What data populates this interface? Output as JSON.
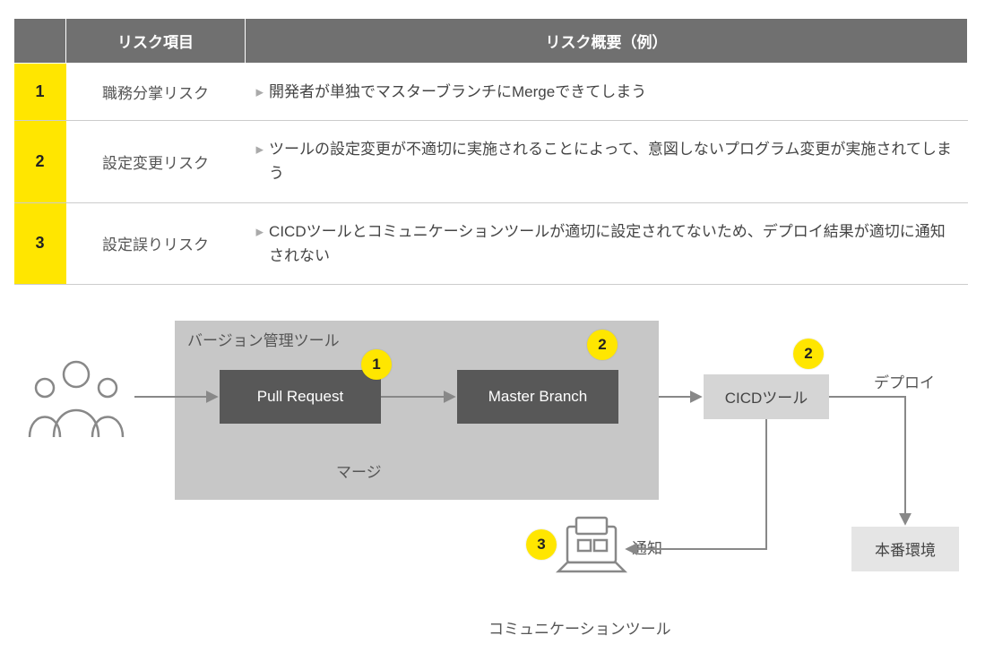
{
  "table": {
    "headers": {
      "num": "",
      "item": "リスク項目",
      "desc": "リスク概要（例）"
    },
    "rows": [
      {
        "num": "1",
        "item": "職務分掌リスク",
        "desc": "開発者が単独でマスターブランチにMergeできてしまう"
      },
      {
        "num": "2",
        "item": "設定変更リスク",
        "desc": "ツールの設定変更が不適切に実施されることによって、意図しないプログラム変更が実施されてしまう"
      },
      {
        "num": "3",
        "item": "設定誤りリスク",
        "desc": "CICDツールとコミュニケーションツールが適切に設定されてないため、デプロイ結果が適切に通知されない"
      }
    ]
  },
  "diagram": {
    "vcs_title": "バージョン管理ツール",
    "pull_request": "Pull Request",
    "master_branch": "Master Branch",
    "cicd": "CICDツール",
    "prod": "本番環境",
    "merge_label": "マージ",
    "deploy_label": "デプロイ",
    "notify_label": "通知",
    "comm_tool_label": "コミュニケーションツール",
    "badges": {
      "b1": "1",
      "b2": "2",
      "b3": "3"
    }
  }
}
